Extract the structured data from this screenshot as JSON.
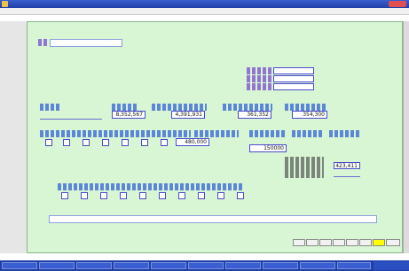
{
  "window": {
    "title": "",
    "title_bar_color": "#1f3fa8",
    "panel_color": "#d8f5d4"
  },
  "menu": {
    "items": [
      "",
      "",
      "",
      "",
      "",
      "",
      "",
      "",
      "",
      "",
      ""
    ]
  },
  "status_text": "",
  "header": {
    "code": ""
  },
  "fields": {
    "date": "",
    "count1": "",
    "count2": "",
    "amount1": "8,352,567",
    "amount2": "4,391,931",
    "amount3": "361,352",
    "amount4": "354,300",
    "amount5": "480,000",
    "amount6": "150000",
    "amount7": "423,411"
  },
  "bottom": {
    "path_text": ""
  },
  "buttons": {
    "items": [
      "",
      "",
      "",
      "",
      "",
      "",
      "",
      ""
    ]
  },
  "taskbar": {
    "items": [
      "",
      "",
      "",
      "",
      "",
      "",
      "",
      "",
      "",
      ""
    ],
    "time": ""
  }
}
